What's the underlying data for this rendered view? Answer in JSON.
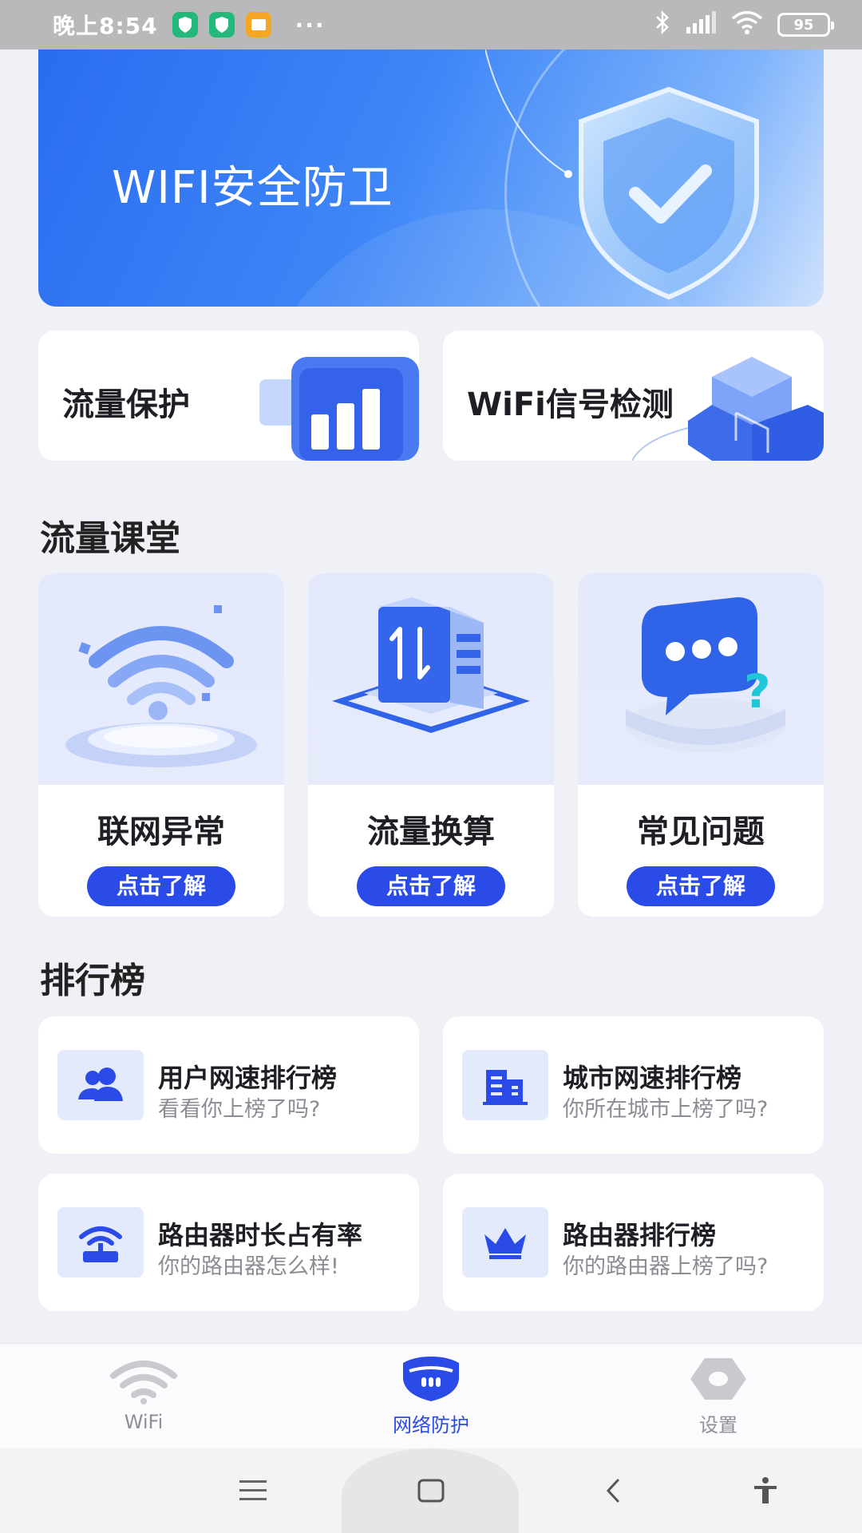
{
  "status_bar": {
    "time": "晚上8:54",
    "dots": "···",
    "battery": "95",
    "icons": [
      "shield-app-icon",
      "shield-app-icon",
      "image-app-icon",
      "bluetooth-icon",
      "signal-icon",
      "wifi-icon",
      "battery-icon"
    ]
  },
  "banner": {
    "title": "WIFI安全防卫"
  },
  "quick_cards": [
    {
      "label": "流量保护",
      "icon": "bar-chart-icon"
    },
    {
      "label": "WiFi信号检测",
      "icon": "cube-icon"
    }
  ],
  "lessons": {
    "section_title": "流量课堂",
    "items": [
      {
        "title": "联网异常",
        "button": "点击了解",
        "icon": "wifi-icon"
      },
      {
        "title": "流量换算",
        "button": "点击了解",
        "icon": "transfer-icon"
      },
      {
        "title": "常见问题",
        "button": "点击了解",
        "icon": "chat-question-icon"
      }
    ]
  },
  "ranking": {
    "section_title": "排行榜",
    "items": [
      {
        "title": "用户网速排行榜",
        "subtitle": "看看你上榜了吗?",
        "icon": "users-icon"
      },
      {
        "title": "城市网速排行榜",
        "subtitle": "你所在城市上榜了吗?",
        "icon": "building-icon"
      },
      {
        "title": "路由器时长占有率",
        "subtitle": "你的路由器怎么样!",
        "icon": "router-icon"
      },
      {
        "title": "路由器排行榜",
        "subtitle": "你的路由器上榜了吗?",
        "icon": "crown-icon"
      }
    ]
  },
  "tabbar": {
    "tabs": [
      {
        "label": "WiFi",
        "icon": "wifi-icon",
        "active": false
      },
      {
        "label": "网络防护",
        "icon": "shield-icon",
        "active": true
      },
      {
        "label": "设置",
        "icon": "settings-hex-icon",
        "active": false
      }
    ]
  },
  "colors": {
    "accent": "#2b4be8",
    "background": "#f0f1f6",
    "banner": "#3e86f7"
  }
}
